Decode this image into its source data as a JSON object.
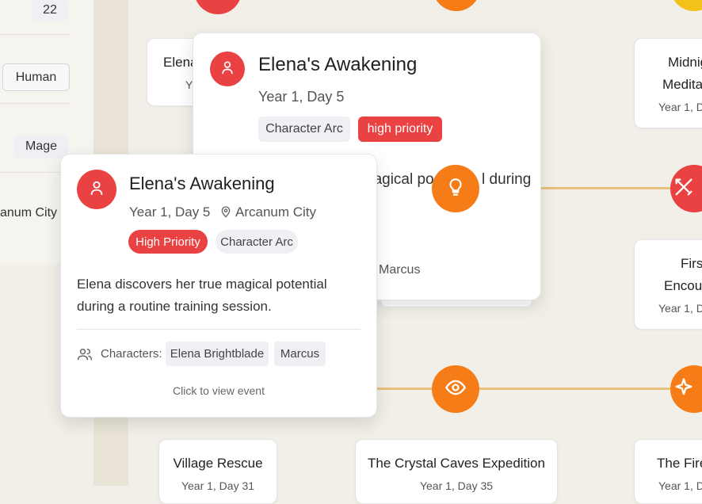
{
  "sidebar": {
    "age_value": "22",
    "race_value": "Human",
    "class_value": "Mage",
    "location_value": "anum City"
  },
  "background_nodes": {
    "card_left_partial_title": "Elena",
    "card_left_partial_sub": "Y",
    "card_right_top_title_1": "Midnig",
    "card_right_top_title_2": "Medita",
    "card_right_top_date": "Year 1, D",
    "card_right_mid_title_1": "Firs",
    "card_right_mid_title_2": "Encour",
    "card_right_mid_date": "Year 1, D",
    "village_title": "Village Rescue",
    "village_date": "Year 1, Day 31",
    "crystal_title": "The Crystal Caves Expedition",
    "crystal_date": "Year 1, Day 35",
    "fire_title": "The Fire",
    "fire_date": "Year 1, D"
  },
  "large_card": {
    "title": "Elena's Awakening",
    "date": "Year 1, Day 5",
    "tag_type": "Character Arc",
    "tag_priority": "high priority",
    "desc_partial_1": "nagical po",
    "desc_partial_2": "l during",
    "char_partial": "Marcus"
  },
  "popup": {
    "title": "Elena's Awakening",
    "date": "Year 1, Day 5",
    "location": "Arcanum City",
    "tag_priority": "High Priority",
    "tag_type": "Character Arc",
    "description": "Elena discovers her true magical potential during a routine training session.",
    "characters_label": "Characters:",
    "characters": [
      "Elena Brightblade",
      "Marcus"
    ],
    "footer_hint": "Click to view event"
  },
  "icons": {
    "avatar": "user-icon",
    "pin": "map-pin-icon",
    "users": "users-icon",
    "lightbulb": "lightbulb-icon",
    "eye": "eye-icon",
    "swords": "swords-icon",
    "sparkle": "sparkle-icon"
  },
  "colors": {
    "red": "#ea4242",
    "orange": "#f57c17",
    "yellow": "#f2c11a",
    "line": "#e7c27d"
  }
}
